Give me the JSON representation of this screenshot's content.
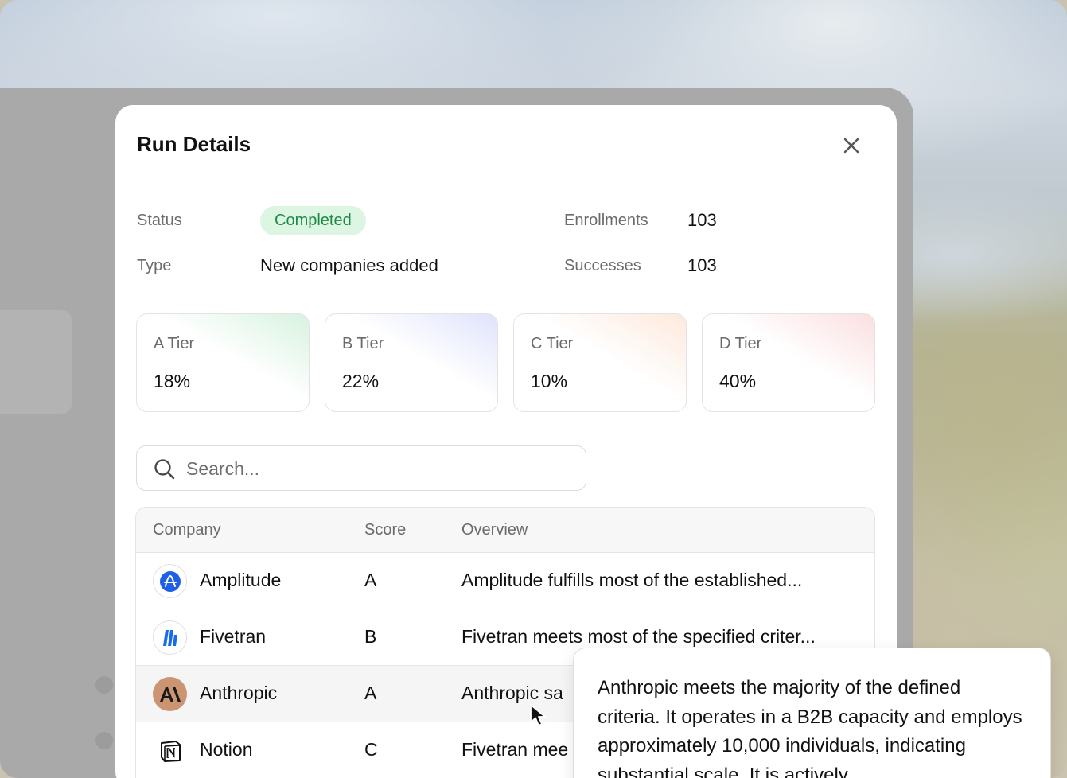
{
  "modal": {
    "title": "Run Details"
  },
  "info": {
    "status_label": "Status",
    "status_value": "Completed",
    "type_label": "Type",
    "type_value": "New companies added",
    "enrollments_label": "Enrollments",
    "enrollments_value": "103",
    "successes_label": "Successes",
    "successes_value": "103"
  },
  "tiers": [
    {
      "label": "A Tier",
      "value": "18%",
      "color": "#d7f2df"
    },
    {
      "label": "B Tier",
      "value": "22%",
      "color": "#dfe3fb"
    },
    {
      "label": "C Tier",
      "value": "10%",
      "color": "#fde9dc"
    },
    {
      "label": "D Tier",
      "value": "40%",
      "color": "#fbdfe0"
    }
  ],
  "search": {
    "placeholder": "Search...",
    "icon": "search-icon"
  },
  "table": {
    "headers": [
      "Company",
      "Score",
      "Overview"
    ],
    "rows": [
      {
        "company": "Amplitude",
        "score": "A",
        "overview": "Amplitude fulfills most of the established...",
        "logo": "amplitude-logo-icon"
      },
      {
        "company": "Fivetran",
        "score": "B",
        "overview": "Fivetran meets most of the specified criter...",
        "logo": "fivetran-logo-icon"
      },
      {
        "company": "Anthropic",
        "score": "A",
        "overview": "Anthropic sa",
        "logo": "anthropic-logo-icon"
      },
      {
        "company": "Notion",
        "score": "C",
        "overview": "Fivetran mee",
        "logo": "notion-logo-icon"
      }
    ]
  },
  "tooltip": {
    "text": "Anthropic meets the majority of the defined criteria. It operates in a B2B capacity and employs approximately 10,000 individuals, indicating substantial scale. It is actively"
  }
}
